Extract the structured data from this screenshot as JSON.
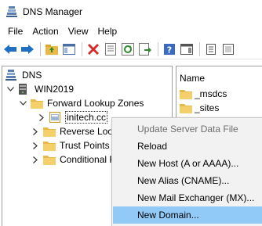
{
  "window": {
    "title": "DNS Manager"
  },
  "menu": [
    "File",
    "Action",
    "View",
    "Help"
  ],
  "toolbar": {
    "icons": [
      "back-arrow-icon",
      "forward-arrow-icon",
      "up-folder-icon",
      "show-hide-console-tree-icon",
      "delete-icon",
      "properties-icon",
      "refresh-icon",
      "export-list-icon",
      "help-icon",
      "show-action-pane-icon",
      "view-list-icon",
      "view-detail-icon",
      "view-large-icon"
    ],
    "colors": {
      "arrow": "#1f6fc5",
      "delete": "#d42a2a",
      "folder": "#e8b948",
      "help": "#3a6bc4"
    }
  },
  "tree": {
    "root": "DNS",
    "server": "WIN2019",
    "zones": [
      {
        "label": "Forward Lookup Zones",
        "expanded": true
      },
      {
        "label": "initech.cc",
        "selected": true
      },
      {
        "label": "Reverse Looku"
      },
      {
        "label": "Trust Points"
      },
      {
        "label": "Conditional F"
      }
    ]
  },
  "list": {
    "header": "Name",
    "rows": [
      "_msdcs",
      "_sites"
    ]
  },
  "context_menu": {
    "items": [
      {
        "label": "Update Server Data File",
        "disabled": true
      },
      {
        "label": "Reload"
      },
      {
        "label": "New Host (A or AAAA)..."
      },
      {
        "label": "New Alias (CNAME)..."
      },
      {
        "label": "New Mail Exchanger (MX)..."
      },
      {
        "label": "New Domain...",
        "highlighted": true
      }
    ],
    "highlight_color": "#91c9f7"
  }
}
